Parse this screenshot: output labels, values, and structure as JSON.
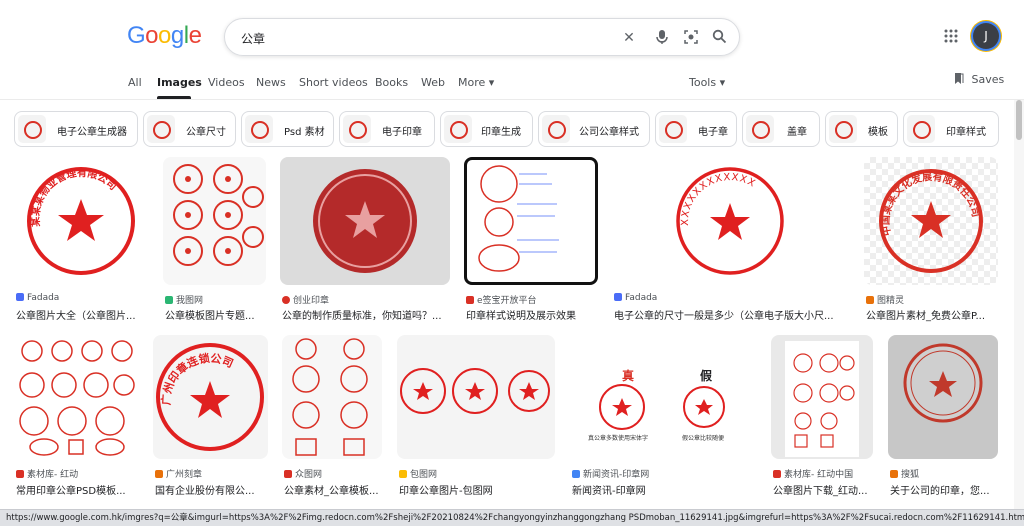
{
  "logo": {
    "letters": [
      "G",
      "o",
      "o",
      "g",
      "l",
      "e"
    ],
    "colors": [
      "#4285f4",
      "#ea4335",
      "#fbbc05",
      "#4285f4",
      "#34a853",
      "#ea4335"
    ]
  },
  "search": {
    "query": "公章"
  },
  "tabs": [
    "All",
    "Images",
    "Videos",
    "News",
    "Short videos",
    "Books",
    "Web",
    "More ▾"
  ],
  "tools_label": "Tools ▾",
  "saves_label": "Saves",
  "avatar_letter": "J",
  "chips": [
    "电子公章生成器",
    "公章尺寸",
    "Psd 素材",
    "电子印章",
    "印章生成",
    "公司公章样式",
    "电子章",
    "盖章",
    "模板",
    "印章样式"
  ],
  "row1": [
    {
      "source": "Fadada",
      "title": "公章图片大全（公章图片...",
      "fav": "#4a6cf7",
      "seal": "某某某物业管理有限公司"
    },
    {
      "source": "我图网",
      "title": "公章模板图片专题...",
      "fav": "#2bb673",
      "seal": ""
    },
    {
      "source": "创业印章",
      "title": "公章的制作质量标准，你知道吗？...",
      "fav": "#d93025",
      "seal": ""
    },
    {
      "source": "e签宝开放平台",
      "title": "印章样式说明及展示效果",
      "fav": "#d93025",
      "seal": ""
    },
    {
      "source": "Fadada",
      "title": "电子公章的尺寸一般是多少（公章电子版大小尺...",
      "fav": "#4a6cf7",
      "seal": "XXXXXXXXXXXX"
    },
    {
      "source": "图精灵",
      "title": "公章图片素材_免费公章P...",
      "fav": "#e8710a",
      "seal": "中国某某文化发展有限责任公司"
    }
  ],
  "row2": [
    {
      "source": "素材库- 红动",
      "title": "常用印章公章PSD模板...",
      "fav": "#d93025",
      "seal": ""
    },
    {
      "source": "广州刻章",
      "title": "国有企业股份有限公...",
      "fav": "#e8710a",
      "seal": "广州印章连锁公司"
    },
    {
      "source": "众图网",
      "title": "公章素材_公章模板...",
      "fav": "#d93025",
      "seal": ""
    },
    {
      "source": "包图网",
      "title": "印章公章图片-包图网",
      "fav": "#fbbc04",
      "seal": ""
    },
    {
      "source": "新闻资讯-印章网",
      "title": "新闻资讯-印章网",
      "fav": "#4285f4",
      "seal": "",
      "labels": [
        "真",
        "假"
      ],
      "captions": [
        "真公章多数使用宋体字",
        "假公章比较随便"
      ]
    },
    {
      "source": "素材库- 红动中国",
      "title": "公章图片下载_红动...",
      "fav": "#d93025",
      "seal": ""
    },
    {
      "source": "搜狐",
      "title": "关于公司的印章，您...",
      "fav": "#e8710a",
      "seal": ""
    }
  ],
  "status_url": "https://www.google.com.hk/imgres?q=公章&imgurl=https%3A%2F%2Fimg.redocn.com%2Fsheji%2F20210824%2Fchangyongyinzhanggongzhang PSDmoban_11629141.jpg&imgrefurl=https%3A%2F%2Fsucai.redocn.com%2F11629141.html&docid=GrWch7_p8lLl..."
}
